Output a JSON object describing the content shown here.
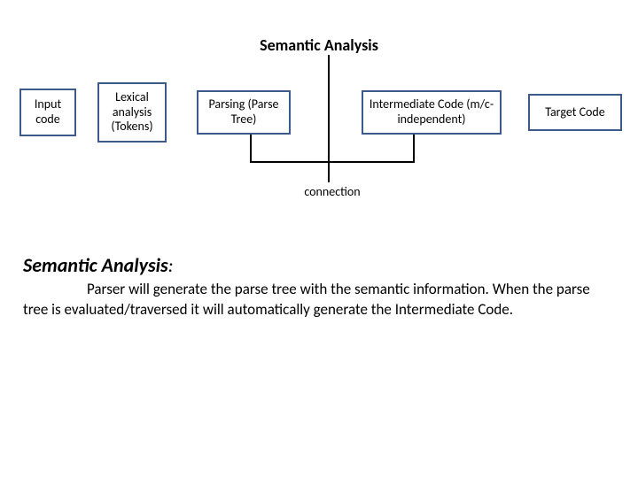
{
  "title": "Semantic Analysis",
  "boxes": {
    "input": "Input code",
    "lexical": "Lexical analysis (Tokens)",
    "parsing": "Parsing (Parse Tree)",
    "intermediate": "Intermediate Code (m/c-independent)",
    "target": "Target Code"
  },
  "connection_label": "connection",
  "section_heading": "Semantic Analysis",
  "section_heading_suffix": ":",
  "body_text": "Parser will generate the parse tree with the semantic information. When the parse tree is evaluated/traversed it will automatically generate the Intermediate Code."
}
